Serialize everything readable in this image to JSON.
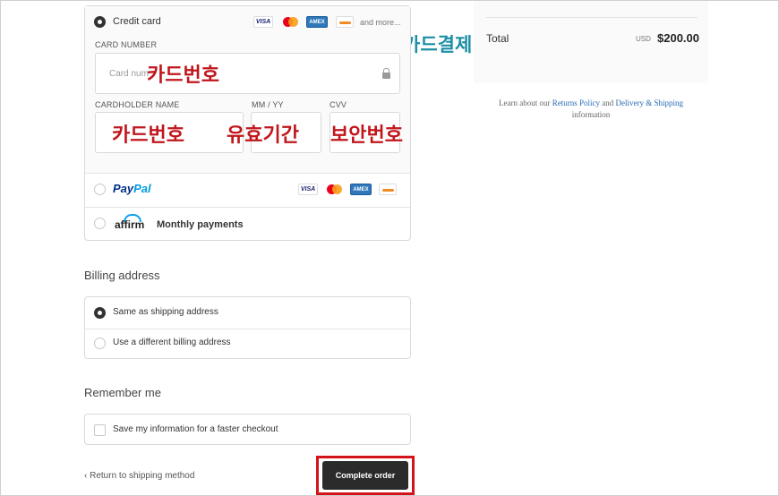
{
  "payment": {
    "credit_card_label": "Credit card",
    "and_more": "and more...",
    "card_number_label": "CARD NUMBER",
    "card_number_placeholder": "Card num",
    "cardholder_label": "CARDHOLDER NAME",
    "expiry_label": "MM / YY",
    "cvv_label": "CVV",
    "paypal_part1": "Pay",
    "paypal_part2": "Pal",
    "affirm_logo": "affirm",
    "affirm_text": "Monthly payments",
    "badges": {
      "visa": "VISA",
      "amex": "AMEX"
    }
  },
  "annotations": {
    "card_payment": "카드결제",
    "card_number": "카드번호",
    "cardholder": "카드번호",
    "expiry": "유효기간",
    "security_code": "보안번호"
  },
  "billing": {
    "title": "Billing address",
    "same_as_shipping": "Same as shipping address",
    "different": "Use a different billing address"
  },
  "remember": {
    "title": "Remember me",
    "save_info": "Save my information for a faster checkout"
  },
  "footer": {
    "return_link": "Return to shipping method",
    "complete_button": "Complete order"
  },
  "summary": {
    "total_label": "Total",
    "currency": "USD",
    "total_amount": "$200.00",
    "policy_prefix": "Learn about our",
    "return_policy": "Returns Policy",
    "policy_and": "and",
    "delivery_shipping": "Delivery & Shipping",
    "policy_suffix": "information"
  },
  "colors": {
    "annotation_red": "#c0161c",
    "annotation_teal": "#1c8fa6",
    "button_bg": "#2b2b2b",
    "highlight_border": "#d4121a",
    "link": "#2a6bb5"
  }
}
